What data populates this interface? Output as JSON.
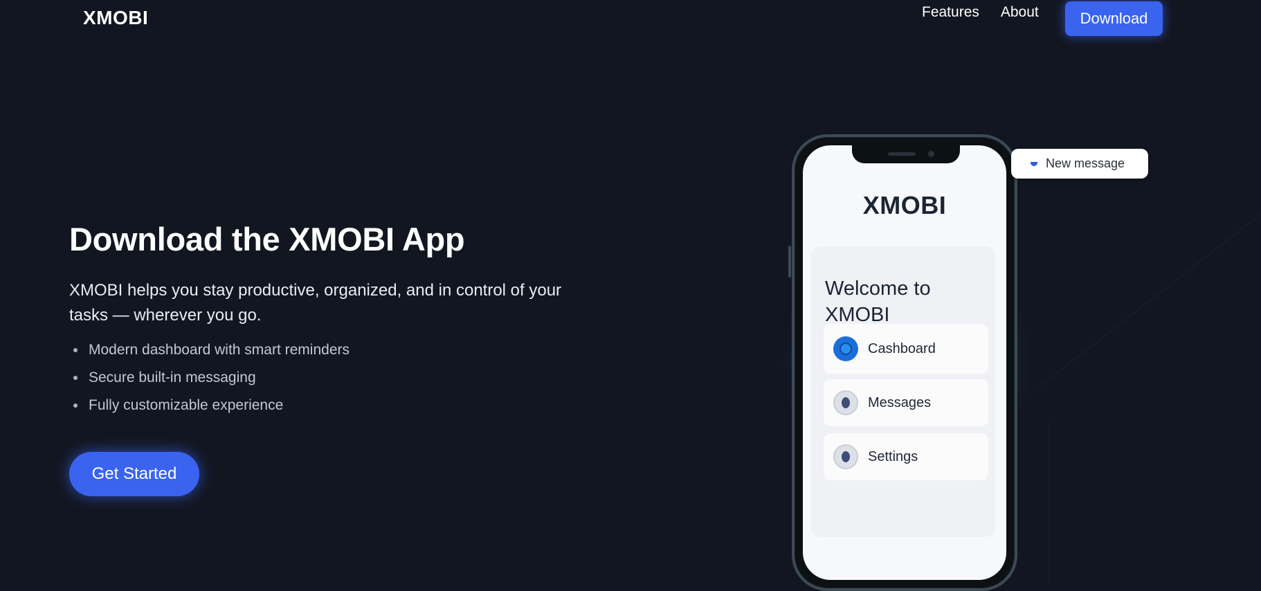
{
  "header": {
    "logo": "XMOBI",
    "nav": [
      {
        "label": "Features"
      },
      {
        "label": "About"
      }
    ],
    "download_label": "Download"
  },
  "hero": {
    "title": "Download the XMOBI App",
    "description": "XMOBI helps you stay productive, organized, and in control of your tasks — wherever you go.",
    "features": [
      "Modern dashboard with smart reminders",
      "Secure built-in messaging",
      "Fully customizable experience"
    ],
    "cta_label": "Get Started"
  },
  "phone": {
    "app_title": "XMOBI",
    "welcome": "Welcome to XMOBI",
    "menu": [
      {
        "label": "Cashboard",
        "icon": "dashboard-icon",
        "active": true
      },
      {
        "label": "Messages",
        "icon": "messages-icon",
        "active": false
      },
      {
        "label": "Settings",
        "icon": "settings-icon",
        "active": false
      }
    ]
  },
  "notification": {
    "text": "New message",
    "icon": "message-icon"
  },
  "colors": {
    "background": "#121620",
    "accent": "#3a63f0",
    "phone_screen": "#f7f8fa"
  }
}
